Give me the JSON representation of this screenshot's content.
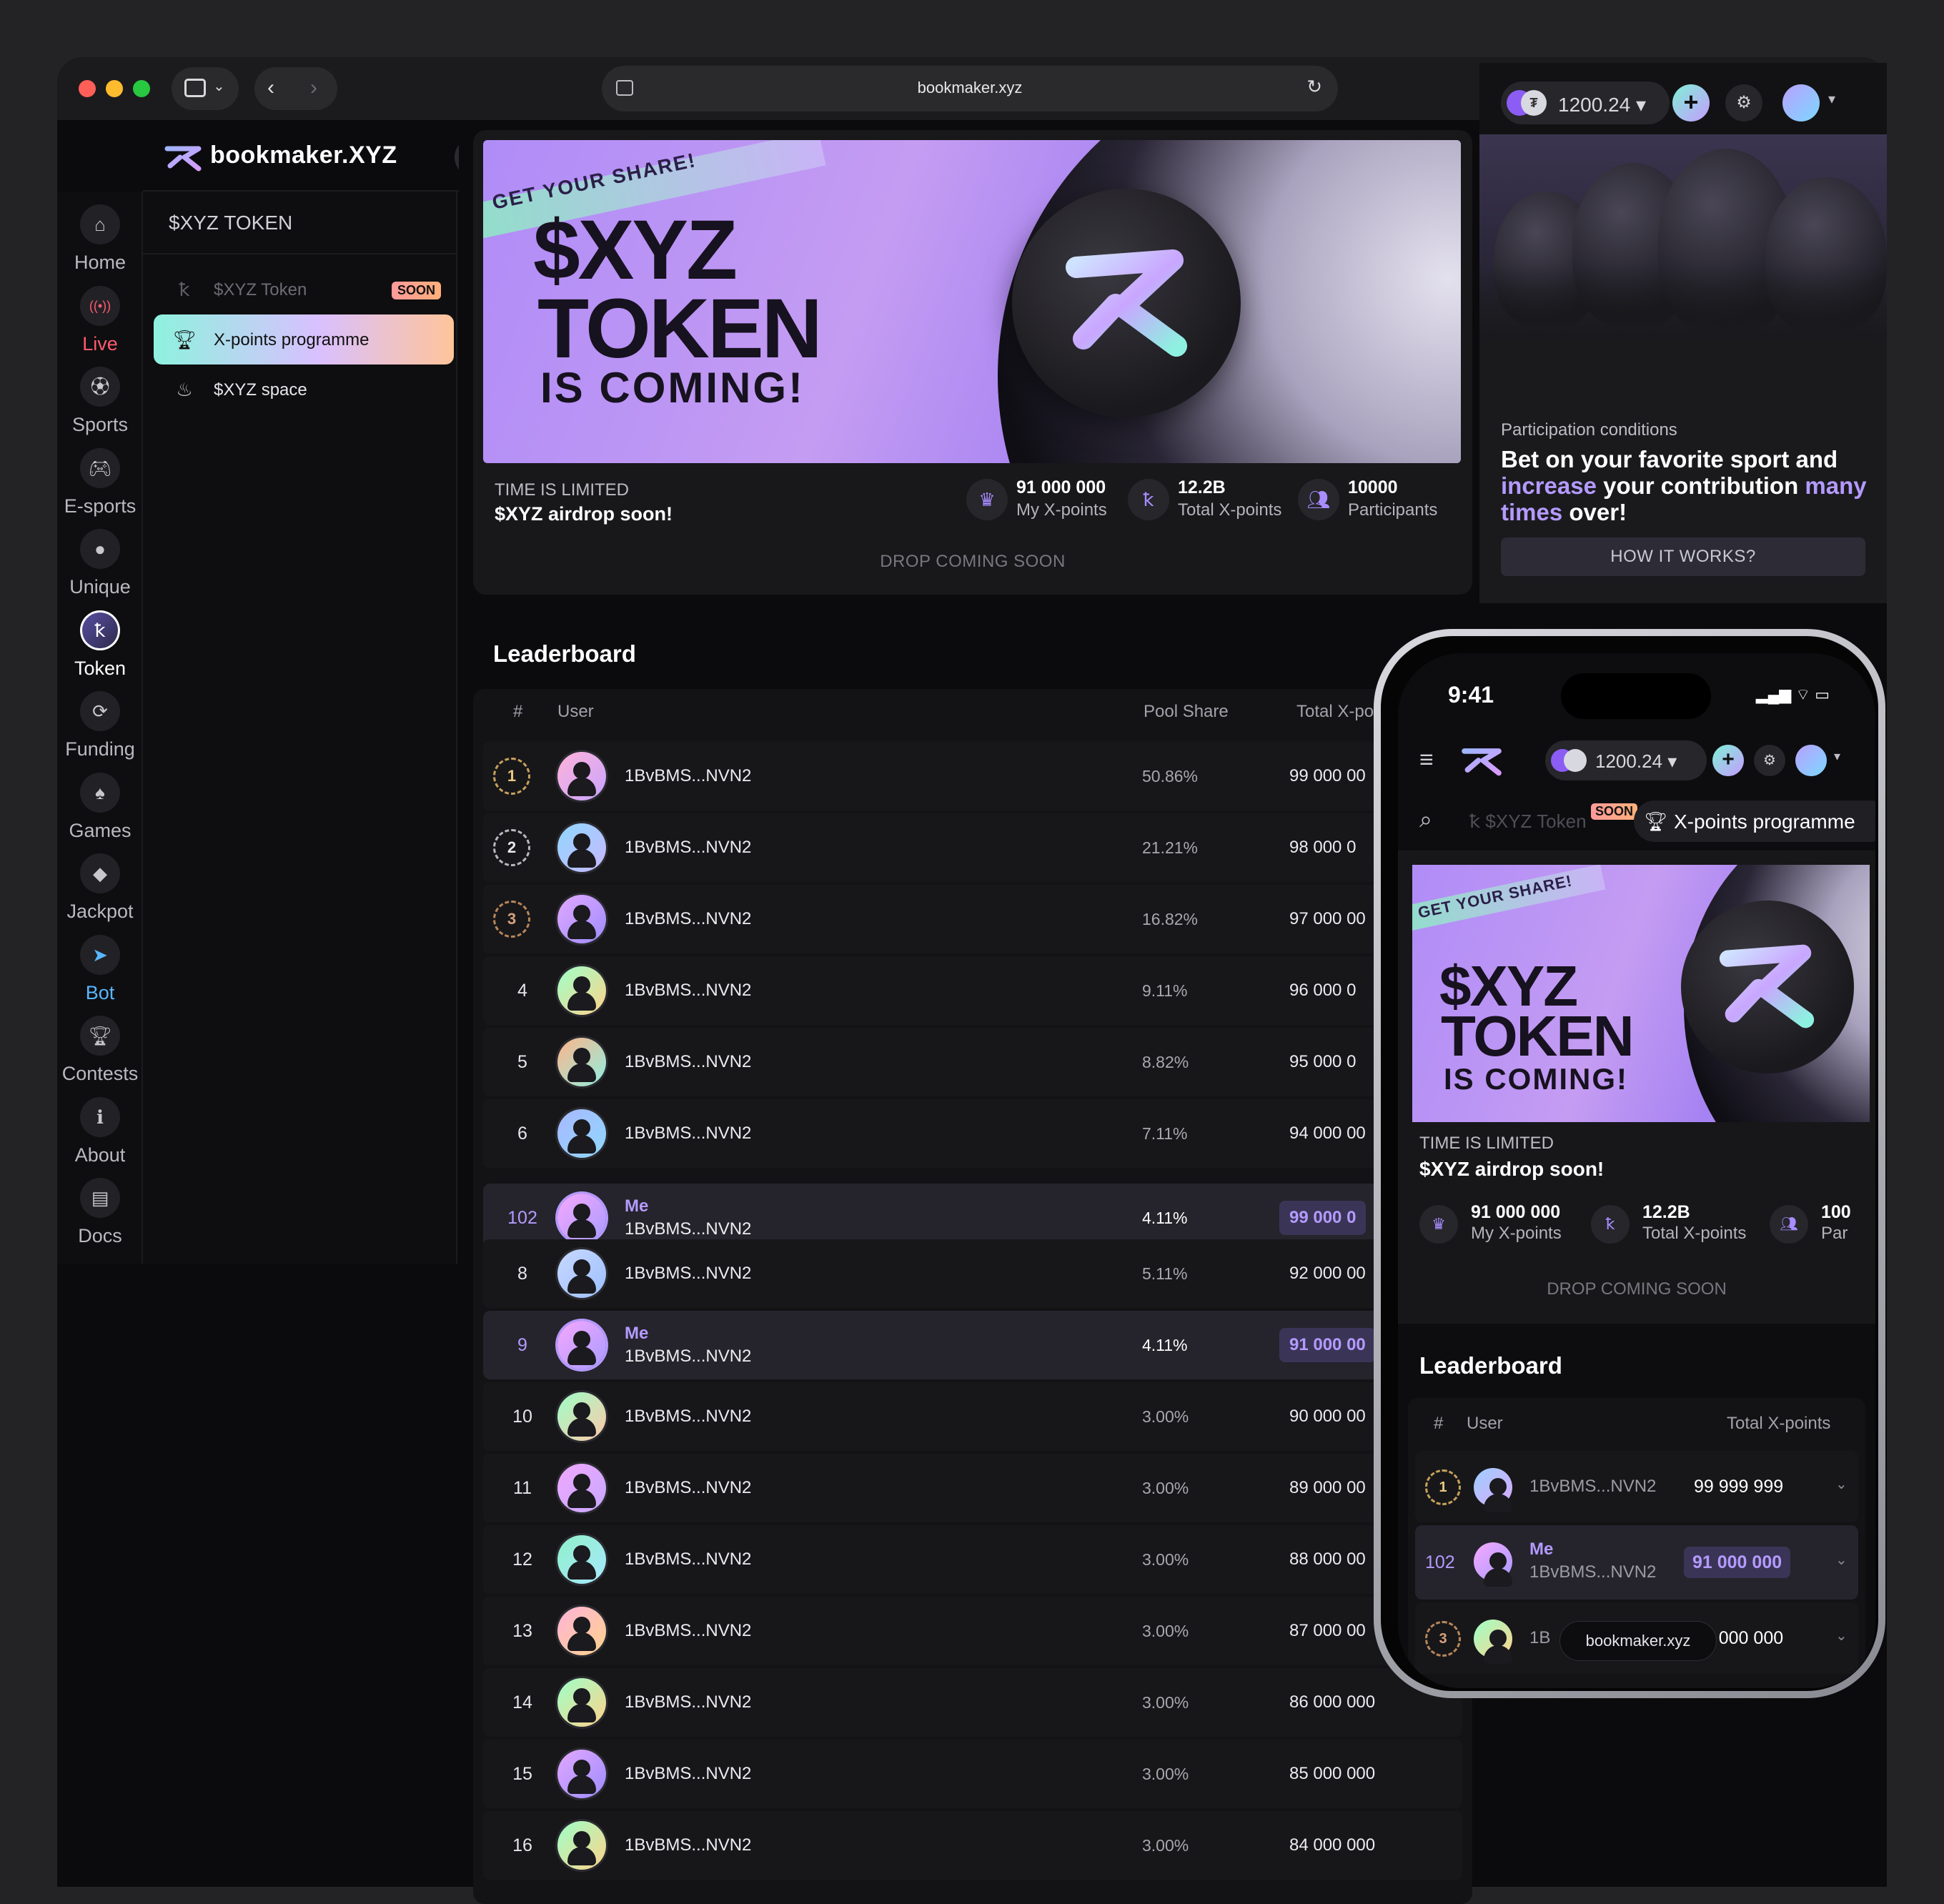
{
  "browser": {
    "url": "bookmaker.xyz"
  },
  "brand": {
    "name": "bookmaker.XYZ"
  },
  "rail": [
    {
      "label": "Home",
      "icon": "home-icon"
    },
    {
      "label": "Live",
      "icon": "live-icon"
    },
    {
      "label": "Sports",
      "icon": "sports-icon"
    },
    {
      "label": "E-sports",
      "icon": "gamepad-icon"
    },
    {
      "label": "Unique",
      "icon": "unique-icon"
    },
    {
      "label": "Token",
      "icon": "token-icon"
    },
    {
      "label": "Funding",
      "icon": "funding-icon"
    },
    {
      "label": "Games",
      "icon": "games-icon"
    },
    {
      "label": "Jackpot",
      "icon": "diamond-icon"
    },
    {
      "label": "Bot",
      "icon": "telegram-icon"
    },
    {
      "label": "Contests",
      "icon": "trophy-icon"
    },
    {
      "label": "About",
      "icon": "about-icon"
    },
    {
      "label": "Docs",
      "icon": "docs-icon"
    }
  ],
  "subnav": {
    "title": "$XYZ TOKEN",
    "items": [
      {
        "label": "$XYZ Token",
        "badge": "SOON"
      },
      {
        "label": "X-points programme"
      },
      {
        "label": "$XYZ space"
      }
    ]
  },
  "hero": {
    "strip": "GET YOUR SHARE!",
    "title_line1": "$XYZ",
    "title_line2": "TOKEN",
    "title_line3": "IS COMING!",
    "limited": "TIME IS LIMITED",
    "airdrop": "$XYZ airdrop soon!",
    "stats": [
      {
        "value": "91 000 000",
        "label": "My X-points"
      },
      {
        "value": "12.2B",
        "label": "Total X-points"
      },
      {
        "value": "10000",
        "label": "Participants"
      }
    ],
    "drop": "DROP COMING SOON"
  },
  "account": {
    "balance": "1200.24"
  },
  "participation": {
    "label": "Participation conditions",
    "title_a": "Bet on your favorite sport and ",
    "title_b": "increase",
    "title_c": " your contribution ",
    "title_d": "many times",
    "title_e": " over!",
    "button": "HOW IT WORKS?"
  },
  "leaderboard": {
    "title": "Leaderboard",
    "headers": {
      "rank": "#",
      "user": "User",
      "share": "Pool Share",
      "total": "Total X-po"
    },
    "me_label": "Me",
    "rows": [
      {
        "rank": "1",
        "user": "1BvBMS...NVN2",
        "share": "50.86%",
        "total": "99 000 00"
      },
      {
        "rank": "2",
        "user": "1BvBMS...NVN2",
        "share": "21.21%",
        "total": "98 000 0"
      },
      {
        "rank": "3",
        "user": "1BvBMS...NVN2",
        "share": "16.82%",
        "total": "97 000 00"
      },
      {
        "rank": "4",
        "user": "1BvBMS...NVN2",
        "share": "9.11%",
        "total": "96 000 0"
      },
      {
        "rank": "5",
        "user": "1BvBMS...NVN2",
        "share": "8.82%",
        "total": "95 000 0"
      },
      {
        "rank": "6",
        "user": "1BvBMS...NVN2",
        "share": "7.11%",
        "total": "94 000 00"
      },
      {
        "rank": "102",
        "user": "1BvBMS...NVN2",
        "share": "4.11%",
        "total": "99 000 0"
      },
      {
        "rank": "8",
        "user": "1BvBMS...NVN2",
        "share": "5.11%",
        "total": "92 000 00"
      },
      {
        "rank": "9",
        "user": "1BvBMS...NVN2",
        "share": "4.11%",
        "total": "91 000 00"
      },
      {
        "rank": "10",
        "user": "1BvBMS...NVN2",
        "share": "3.00%",
        "total": "90 000 00"
      },
      {
        "rank": "11",
        "user": "1BvBMS...NVN2",
        "share": "3.00%",
        "total": "89 000 00"
      },
      {
        "rank": "12",
        "user": "1BvBMS...NVN2",
        "share": "3.00%",
        "total": "88 000 00"
      },
      {
        "rank": "13",
        "user": "1BvBMS...NVN2",
        "share": "3.00%",
        "total": "87 000 00"
      },
      {
        "rank": "14",
        "user": "1BvBMS...NVN2",
        "share": "3.00%",
        "total": "86 000 000"
      },
      {
        "rank": "15",
        "user": "1BvBMS...NVN2",
        "share": "3.00%",
        "total": "85 000 000"
      },
      {
        "rank": "16",
        "user": "1BvBMS...NVN2",
        "share": "3.00%",
        "total": "84 000 000"
      }
    ]
  },
  "phone": {
    "time": "9:41",
    "balance": "1200.24",
    "tab_token": "$XYZ Token",
    "tab_badge": "SOON",
    "tab_xpoints": "X-points programme",
    "strip": "GET YOUR SHARE!",
    "title_line1": "$XYZ",
    "title_line2": "TOKEN",
    "title_line3": "IS COMING!",
    "limited": "TIME IS LIMITED",
    "airdrop": "$XYZ airdrop soon!",
    "stats": [
      {
        "value": "91 000 000",
        "label": "My X-points"
      },
      {
        "value": "12.2B",
        "label": "Total X-points"
      },
      {
        "value": "100",
        "label": "Par"
      }
    ],
    "drop": "DROP COMING SOON",
    "lb_title": "Leaderboard",
    "lb_headers": {
      "rank": "#",
      "user": "User",
      "total": "Total X-points"
    },
    "lb_rows": [
      {
        "rank": "1",
        "user": "1BvBMS...NVN2",
        "total": "99 999 999"
      },
      {
        "rank": "102",
        "me": "Me",
        "user": "1BvBMS...NVN2",
        "total": "91 000 000"
      },
      {
        "rank": "3",
        "user": "1B",
        "total": "97 000 000"
      }
    ],
    "url_pill": "bookmaker.xyz"
  },
  "colors": {
    "accent": "#b49aff",
    "live": "#ff5a6e",
    "bot": "#58b7ff"
  }
}
